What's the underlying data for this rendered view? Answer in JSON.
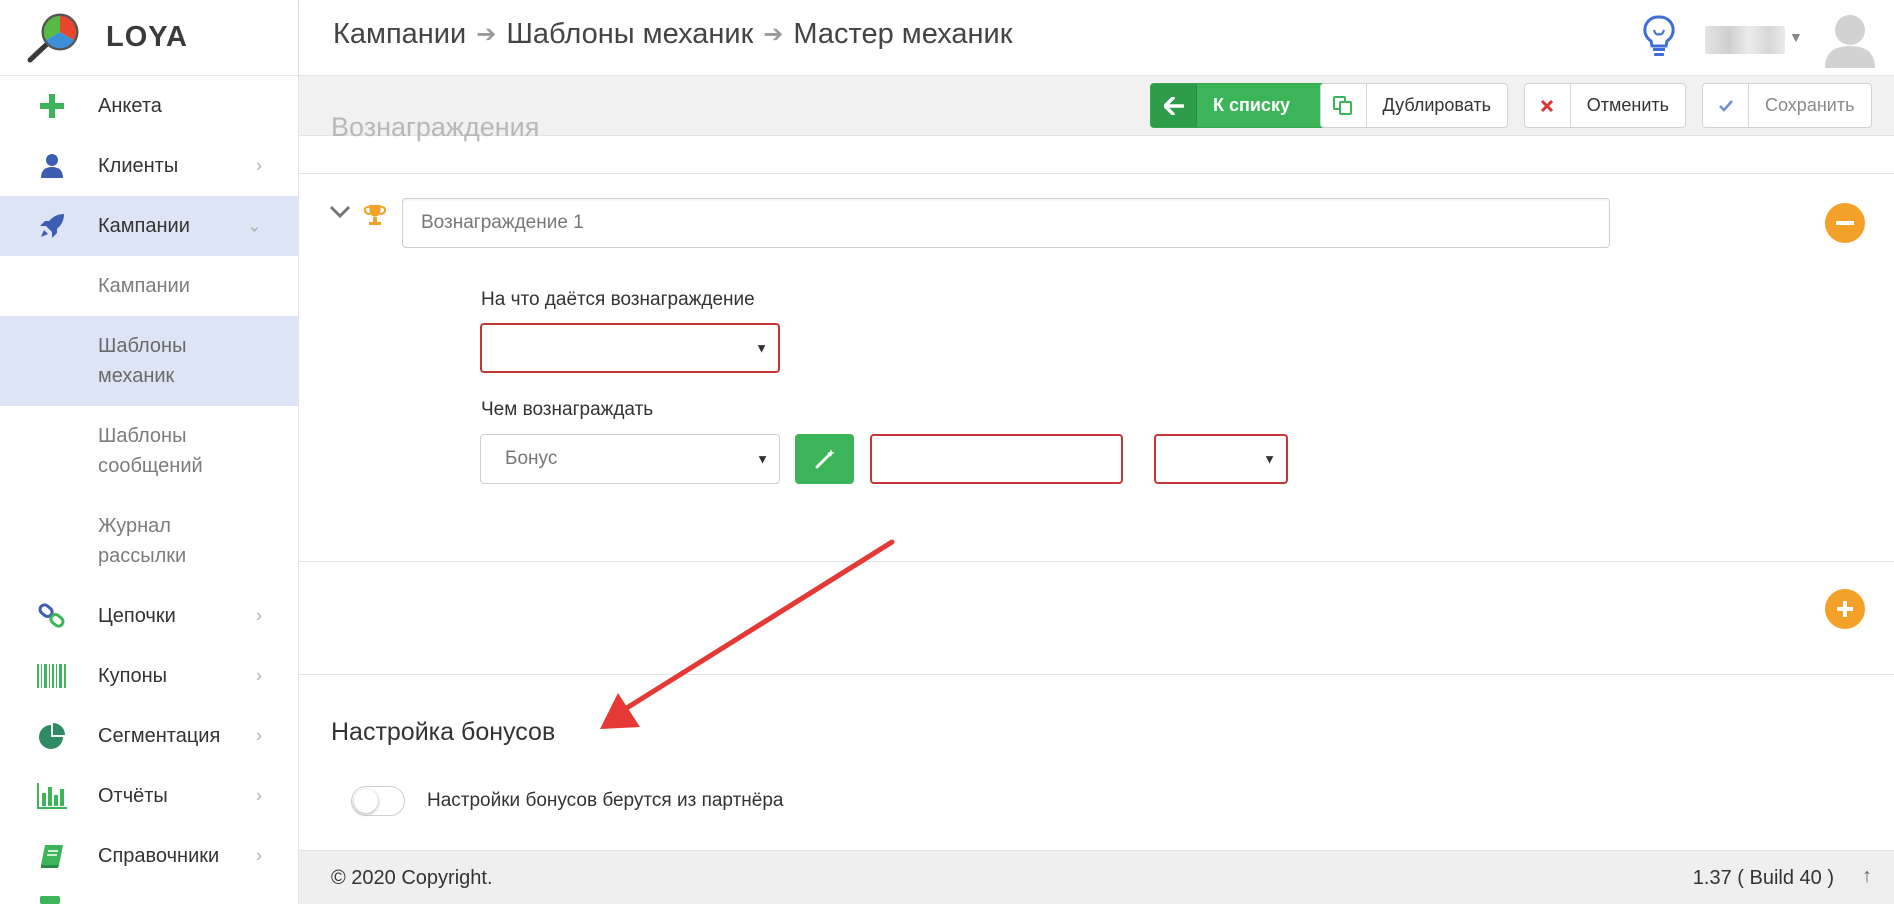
{
  "app": {
    "name": "LOYA"
  },
  "sidebar": {
    "items": [
      {
        "label": "Анкета"
      },
      {
        "label": "Клиенты",
        "chevron": "›"
      },
      {
        "label": "Кампании",
        "chevron": "⌄"
      },
      {
        "label": "Цепочки",
        "chevron": "›"
      },
      {
        "label": "Купоны",
        "chevron": "›"
      },
      {
        "label": "Сегментация",
        "chevron": "›"
      },
      {
        "label": "Отчёты",
        "chevron": "›"
      },
      {
        "label": "Справочники",
        "chevron": "›"
      }
    ],
    "subitems": [
      {
        "label": "Кампании"
      },
      {
        "label": "Шаблоны механик"
      },
      {
        "label": "Шаблоны сообщений"
      },
      {
        "label": "Журнал рассылки"
      }
    ]
  },
  "header": {
    "breadcrumbs": [
      "Кампании",
      "Шаблоны механик",
      "Мастер механик"
    ],
    "separator": "➔"
  },
  "toolbar": {
    "back_label": "К списку",
    "duplicate_label": "Дублировать",
    "cancel_label": "Отменить",
    "save_label": "Сохранить"
  },
  "rewards": {
    "section_title": "Вознаграждения",
    "reward_name": "Вознаграждение 1",
    "condition_label": "На что даётся вознаграждение",
    "condition_value": "",
    "reward_type_label": "Чем вознаграждать",
    "reward_type_value": "Бонус",
    "amount_value": "",
    "unit_value": "",
    "select_arrow": "▼"
  },
  "bonus_settings": {
    "title": "Настройка бонусов",
    "toggle_label": "Настройки бонусов берутся из партнёра",
    "toggle_on": false
  },
  "footer": {
    "copyright": "© 2020 Copyright.",
    "version": "1.37 ( Build 40 )",
    "to_top": "↑"
  },
  "colors": {
    "accent_green": "#3cb55a",
    "accent_orange": "#f4a12a",
    "error_red": "#c43535",
    "sidebar_active": "#dde4f5",
    "annotation_red": "#e53935"
  }
}
